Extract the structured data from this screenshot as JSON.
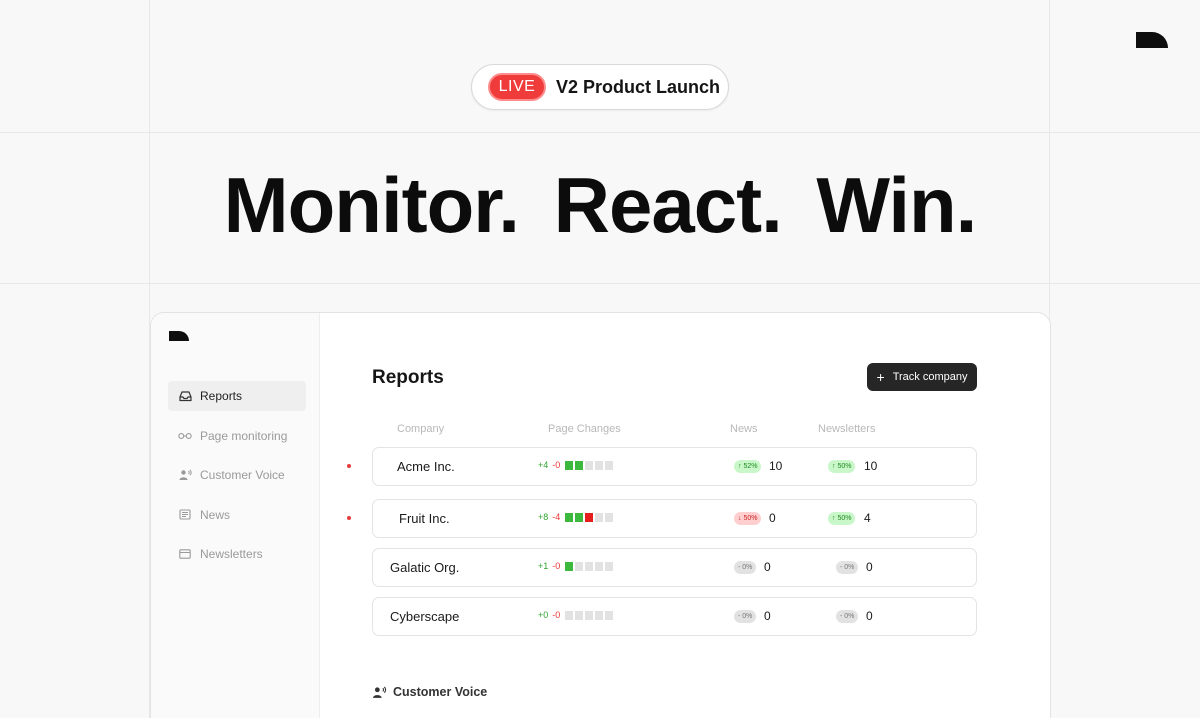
{
  "banner": {
    "live_label": "LIVE",
    "title": "V2 Product Launch"
  },
  "hero": {
    "headline": "Monitor.  React.  Win."
  },
  "sidebar": {
    "items": [
      {
        "label": "Reports",
        "icon": "inbox-icon",
        "active": true
      },
      {
        "label": "Page monitoring",
        "icon": "glasses-icon",
        "active": false
      },
      {
        "label": "Customer Voice",
        "icon": "speaking-person-icon",
        "active": false
      },
      {
        "label": "News",
        "icon": "newspaper-icon",
        "active": false
      },
      {
        "label": "Newsletters",
        "icon": "mail-icon",
        "active": false
      }
    ]
  },
  "main": {
    "title": "Reports",
    "track_button": {
      "label": "Track company",
      "icon": "plus-icon"
    },
    "columns": [
      "Company",
      "Page Changes",
      "News",
      "Newsletters"
    ],
    "rows": [
      {
        "company": "Acme Inc.",
        "unread": true,
        "page_plus": "+4",
        "page_minus": "-0",
        "bars": [
          "g",
          "g",
          "n",
          "n",
          "n"
        ],
        "news_badge": "↑ 52%",
        "news_trend": "up",
        "news_count": "10",
        "newsletter_badge": "↑ 50%",
        "newsletter_trend": "up",
        "newsletter_count": "10"
      },
      {
        "company": "Fruit Inc.",
        "unread": true,
        "page_plus": "+8",
        "page_minus": "-4",
        "bars": [
          "g",
          "g",
          "r",
          "n",
          "n"
        ],
        "news_badge": "↓ 50%",
        "news_trend": "down",
        "news_count": "0",
        "newsletter_badge": "↑ 50%",
        "newsletter_trend": "up",
        "newsletter_count": "4"
      },
      {
        "company": "Galatic Org.",
        "unread": false,
        "page_plus": "+1",
        "page_minus": "-0",
        "bars": [
          "g",
          "n",
          "n",
          "n",
          "n"
        ],
        "news_badge": "- 0%",
        "news_trend": "neutral",
        "news_count": "0",
        "newsletter_badge": "- 0%",
        "newsletter_trend": "neutral",
        "newsletter_count": "0"
      },
      {
        "company": "Cyberscape",
        "unread": false,
        "page_plus": "+0",
        "page_minus": "-0",
        "bars": [
          "n",
          "n",
          "n",
          "n",
          "n"
        ],
        "news_badge": "- 0%",
        "news_trend": "neutral",
        "news_count": "0",
        "newsletter_badge": "- 0%",
        "newsletter_trend": "neutral",
        "newsletter_count": "0"
      }
    ],
    "section_heading": "Customer Voice"
  },
  "colors": {
    "live_red": "#f03b3b",
    "up_green": "#3cb83c",
    "down_red": "#e51d1d",
    "button_dark": "#262626"
  }
}
